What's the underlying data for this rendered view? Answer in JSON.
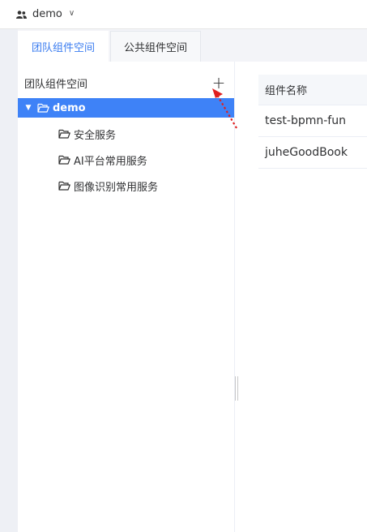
{
  "header": {
    "team_name": "demo",
    "chevron": "∨"
  },
  "tabs": [
    {
      "label": "团队组件空间",
      "active": true
    },
    {
      "label": "公共组件空间",
      "active": false
    }
  ],
  "tree": {
    "title": "团队组件空间",
    "add_symbol": "+",
    "root": {
      "label": "demo",
      "expanded": true
    },
    "children": [
      {
        "label": "安全服务"
      },
      {
        "label": "AI平台常用服务"
      },
      {
        "label": "图像识别常用服务"
      }
    ]
  },
  "table": {
    "column_header": "组件名称",
    "rows": [
      "test-bpmn-fun",
      "juheGoodBook"
    ]
  },
  "icons": {
    "team": "users-icon",
    "folder": "folder-open-icon",
    "caret": "caret-down-icon",
    "add": "plus-icon"
  },
  "colors": {
    "accent": "#3e82f7",
    "active_tab_text": "#3a7cf0",
    "annotation": "#e02020"
  }
}
